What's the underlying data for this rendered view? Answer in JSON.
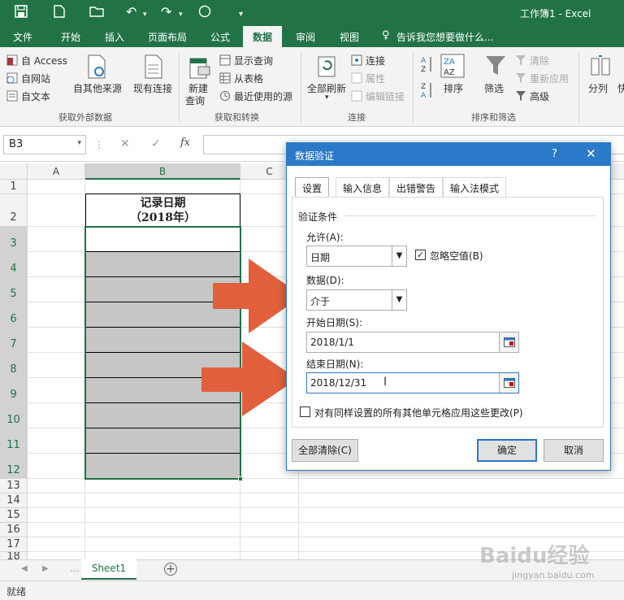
{
  "window": {
    "title": "工作簿1 - Excel"
  },
  "tabs": [
    "文件",
    "开始",
    "插入",
    "页面布局",
    "公式",
    "数据",
    "审阅",
    "视图"
  ],
  "active_tab": "数据",
  "tellme": "告诉我您想要做什么...",
  "ribbon": {
    "access": "自 Access",
    "web": "自网站",
    "text": "自文本",
    "other_sources": "自其他来源",
    "existing": "现有连接",
    "group_external": "获取外部数据",
    "new_query_1": "新建",
    "new_query_2": "查询",
    "show_queries": "显示查询",
    "from_table": "从表格",
    "recent_sources": "最近使用的源",
    "group_transform": "获取和转换",
    "refresh_all": "全部刷新",
    "connections": "连接",
    "properties": "属性",
    "edit_links": "编辑链接",
    "group_connections": "连接",
    "sort": "排序",
    "filter": "筛选",
    "clear": "清除",
    "reapply": "重新应用",
    "advanced": "高级",
    "group_sort_filter": "排序和筛选",
    "split": "分列",
    "quick": "快"
  },
  "formula_bar": {
    "name_box": "B3",
    "fx": "fx",
    "formula": ""
  },
  "columns": [
    "A",
    "B",
    "C"
  ],
  "rows": [
    "1",
    "2",
    "3",
    "4",
    "5",
    "6",
    "7",
    "8",
    "9",
    "10",
    "11",
    "12",
    "13",
    "14",
    "15",
    "16",
    "17",
    "18"
  ],
  "cell_b2": {
    "line1": "记录日期",
    "line2": "（2018年）"
  },
  "sheet": {
    "name": "Sheet1"
  },
  "status": {
    "ready": "就绪"
  },
  "dialog": {
    "title": "数据验证",
    "help": "?",
    "tabs": [
      "设置",
      "输入信息",
      "出错警告",
      "输入法模式"
    ],
    "criteria_label": "验证条件",
    "allow_label": "允许(A):",
    "allow_value": "日期",
    "ignore_blank": "忽略空值(B)",
    "ignore_blank_checked": true,
    "data_label": "数据(D):",
    "data_value": "介于",
    "start_label": "开始日期(S):",
    "start_value": "2018/1/1",
    "end_label": "结束日期(N):",
    "end_value": "2018/12/31",
    "apply_all": "对有同样设置的所有其他单元格应用这些更改(P)",
    "clear_all": "全部清除(C)",
    "ok": "确定",
    "cancel": "取消"
  },
  "watermark": {
    "brand": "Baidu经验",
    "url": "jingyan.baidu.com"
  },
  "colors": {
    "excel_green": "#217346",
    "dialog_blue": "#2b79c9",
    "arrow": "#e0603c",
    "selection_fill": "#c6c6c6"
  }
}
